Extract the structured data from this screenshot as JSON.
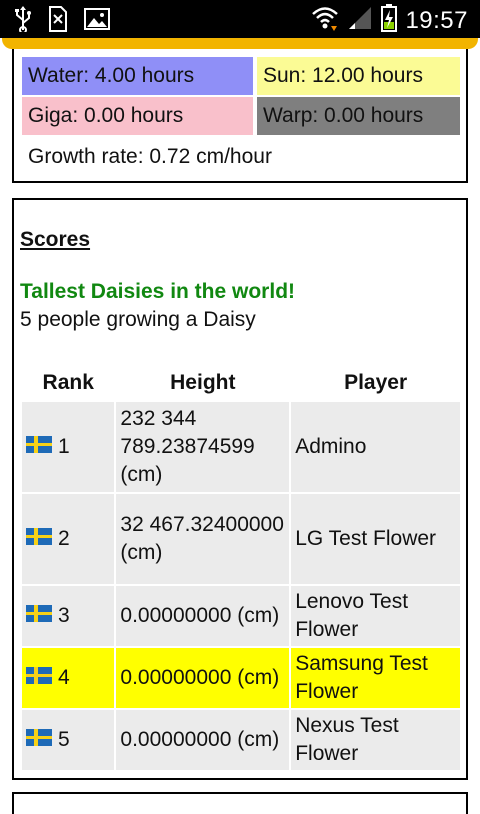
{
  "status_bar": {
    "time": "19:57"
  },
  "growth_card": {
    "water": "Water: 4.00 hours",
    "sun": "Sun: 12.00 hours",
    "giga": "Giga: 0.00 hours",
    "warp": "Warp: 0.00 hours",
    "growth_rate": "Growth rate: 0.72 cm/hour",
    "colors": {
      "water": "#8f8ff7",
      "sun": "#fbfb95",
      "giga": "#f9c0cb",
      "warp": "#7f7f7f"
    }
  },
  "scores": {
    "title": "Scores",
    "headline": "Tallest Daisies in the world!",
    "subline": "5 people growing a Daisy",
    "columns": [
      "Rank",
      "Height",
      "Player"
    ],
    "rows": [
      {
        "rank": "1",
        "height": "232 344 789.23874599 (cm)",
        "player": "Admino",
        "flag": "sweden-flag",
        "highlight": false
      },
      {
        "rank": "2",
        "height": "32 467.32400000 (cm)",
        "player": "LG Test Flower",
        "flag": "sweden-flag",
        "highlight": false
      },
      {
        "rank": "3",
        "height": "0.00000000 (cm)",
        "player": "Lenovo Test Flower",
        "flag": "sweden-flag",
        "highlight": false
      },
      {
        "rank": "4",
        "height": "0.00000000 (cm)",
        "player": "Samsung Test Flower",
        "flag": "sweden-flag",
        "highlight": true
      },
      {
        "rank": "5",
        "height": "0.00000000 (cm)",
        "player": "Nexus Test Flower",
        "flag": "sweden-flag",
        "highlight": false
      }
    ],
    "highlight_color": "#ffff00"
  }
}
